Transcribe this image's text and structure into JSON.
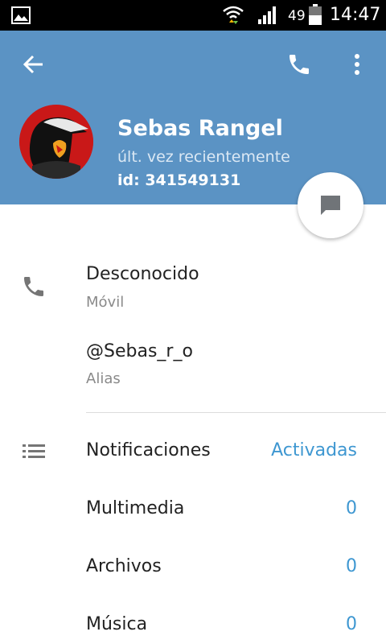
{
  "status_bar": {
    "battery_percent": "49",
    "time": "14:47",
    "icons": [
      "gallery-icon",
      "wifi-icon",
      "signal-icon",
      "battery-icon"
    ]
  },
  "header": {
    "icons": [
      "back-arrow-icon",
      "phone-icon",
      "more-vert-icon"
    ],
    "background_color": "#5b93c4"
  },
  "profile": {
    "name": "Sebas Rangel",
    "last_seen": "últ. vez recientemente",
    "id": "id: 341549131"
  },
  "contact_info": {
    "phone": {
      "value": "Desconocido",
      "label": "Móvil"
    },
    "alias": {
      "value": "@Sebas_r_o",
      "label": "Alias"
    }
  },
  "settings": [
    {
      "label": "Notificaciones",
      "value": "Activadas"
    },
    {
      "label": "Multimedia",
      "value": "0"
    },
    {
      "label": "Archivos",
      "value": "0"
    },
    {
      "label": "Música",
      "value": "0"
    }
  ],
  "accent_color": "#3e97d1"
}
